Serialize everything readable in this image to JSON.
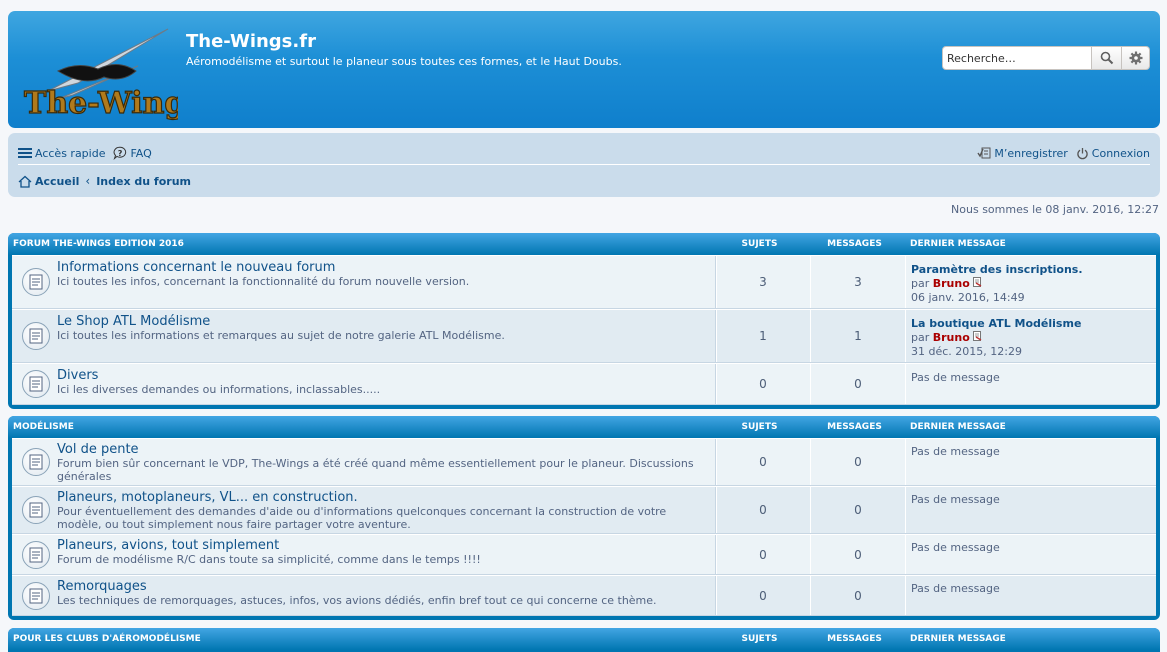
{
  "site": {
    "title": "The-Wings.fr",
    "description": "Aéromodélisme et surtout le planeur sous toutes ces formes, et le Haut Doubs.",
    "logo_text": "The-Wings"
  },
  "search": {
    "placeholder": "Recherche…"
  },
  "nav": {
    "quick_access": "Accès rapide",
    "faq": "FAQ",
    "register": "M’enregistrer",
    "login": "Connexion"
  },
  "breadcrumb": {
    "home": "Accueil",
    "index": "Index du forum"
  },
  "datetime": "Nous sommes le 08 janv. 2016, 12:27",
  "columns": {
    "topics": "Sujets",
    "posts": "Messages",
    "last": "Dernier message"
  },
  "categories": [
    {
      "title": "FORUM THE-WINGS EDITION 2016",
      "forums": [
        {
          "title": "Informations concernant le nouveau forum",
          "desc": "Ici toutes les infos, concernant la fonctionnalité du forum nouvelle version.",
          "topics": "3",
          "posts": "3",
          "last": {
            "title": "Paramètre des inscriptions.",
            "by": "par",
            "author": "Bruno",
            "date": "06 janv. 2016, 14:49"
          }
        },
        {
          "title": "Le Shop ATL Modélisme",
          "desc": "Ici toutes les informations et remarques au sujet de notre galerie ATL Modélisme.",
          "topics": "1",
          "posts": "1",
          "last": {
            "title": "La boutique ATL Modélisme",
            "by": "par",
            "author": "Bruno",
            "date": "31 déc. 2015, 12:29"
          }
        },
        {
          "title": "Divers",
          "desc": "Ici les diverses demandes ou informations, inclassables.....",
          "topics": "0",
          "posts": "0",
          "last": {
            "none": "Pas de message"
          }
        }
      ]
    },
    {
      "title": "MODÉLISME",
      "forums": [
        {
          "title": "Vol de pente",
          "desc": "Forum bien sûr concernant le VDP, The-Wings a été créé quand même essentiellement pour le planeur. Discussions générales",
          "topics": "0",
          "posts": "0",
          "last": {
            "none": "Pas de message"
          }
        },
        {
          "title": "Planeurs, motoplaneurs, VL... en construction.",
          "desc": "Pour éventuellement des demandes d'aide ou d'informations quelconques concernant la construction de votre modèle, ou tout simplement nous faire partager votre aventure.",
          "topics": "0",
          "posts": "0",
          "last": {
            "none": "Pas de message"
          }
        },
        {
          "title": "Planeurs, avions, tout simplement",
          "desc": "Forum de modélisme R/C dans toute sa simplicité, comme dans le temps !!!!",
          "topics": "0",
          "posts": "0",
          "last": {
            "none": "Pas de message"
          }
        },
        {
          "title": "Remorquages",
          "desc": "Les techniques de remorquages, astuces, infos, vos avions dédiés, enfin bref tout ce qui concerne ce thème.",
          "topics": "0",
          "posts": "0",
          "last": {
            "none": "Pas de message"
          }
        }
      ]
    },
    {
      "title": "POUR LES CLUBS D'AÉROMODÉLISME",
      "forums": []
    }
  ],
  "icons": {
    "search": "search-icon",
    "settings": "gear-icon",
    "menu": "menu-icon",
    "faq": "question-icon",
    "register": "register-icon",
    "login": "power-icon",
    "home": "home-icon",
    "forum": "forum-read-icon",
    "view": "view-post-icon"
  }
}
